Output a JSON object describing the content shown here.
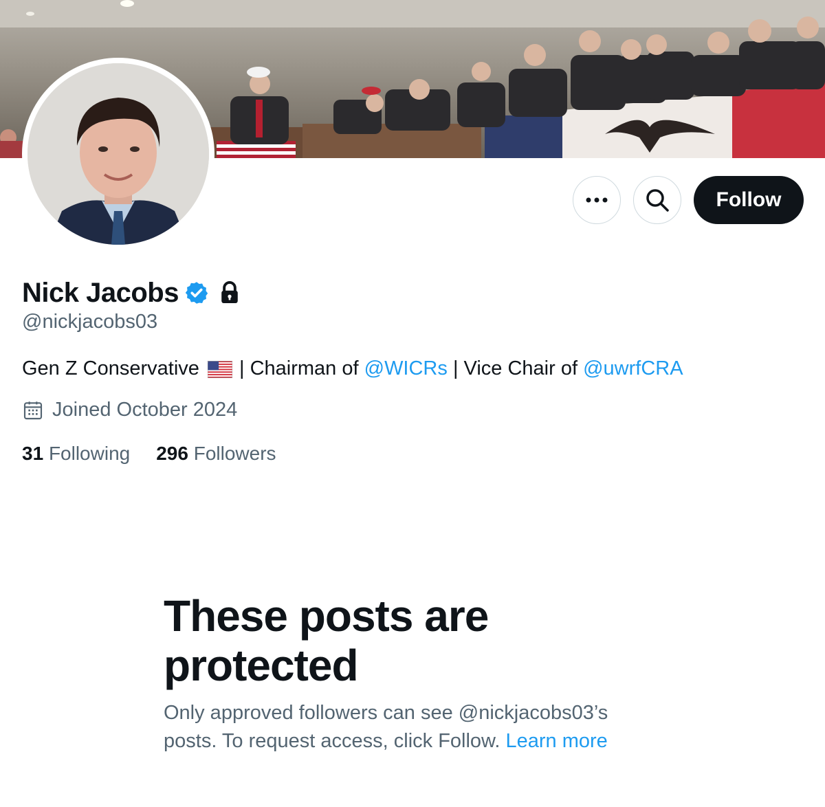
{
  "profile": {
    "display_name": "Nick Jacobs",
    "handle": "@nickjacobs03",
    "bio": {
      "part1": "Gen Z Conservative",
      "flag": "us-flag-emoji",
      "part2": " | Chairman of ",
      "mention1": "@WICRs",
      "part3": " | Vice Chair of ",
      "mention2": "@uwrfCRA"
    },
    "joined": "Joined October 2024",
    "following_count": "31",
    "following_label": "Following",
    "followers_count": "296",
    "followers_label": "Followers"
  },
  "actions": {
    "more_icon": "ellipsis-icon",
    "search_icon": "search-icon",
    "follow_label": "Follow"
  },
  "protected": {
    "title": "These posts are protected",
    "desc": "Only approved followers can see @nickjacobs03’s posts. To request access, click Follow. ",
    "learn_more": "Learn more"
  },
  "colors": {
    "text": "#0f1419",
    "secondary": "#536471",
    "link": "#1d9bf0",
    "verified": "#1d9bf0",
    "follow_bg": "#0f1419"
  }
}
